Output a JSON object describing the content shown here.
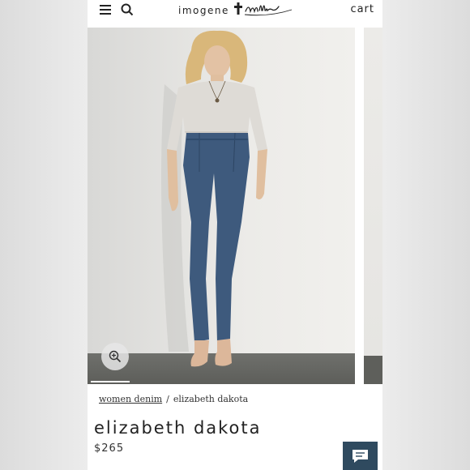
{
  "header": {
    "logo_text": "imogene + willie",
    "cart_label": "cart",
    "menu_icon": "hamburger-menu-icon",
    "search_icon": "search-icon"
  },
  "gallery": {
    "zoom_icon": "zoom-in-icon",
    "image_subject": "model wearing light grey top and medium-wash high-rise jeans"
  },
  "breadcrumb": {
    "parent": "women denim",
    "separator": "/",
    "current": "elizabeth dakota"
  },
  "product": {
    "title": "elizabeth dakota",
    "price": "$265"
  },
  "chat": {
    "icon": "chat-icon"
  },
  "colors": {
    "chat_button": "#2f4a5f",
    "text": "#222222"
  }
}
